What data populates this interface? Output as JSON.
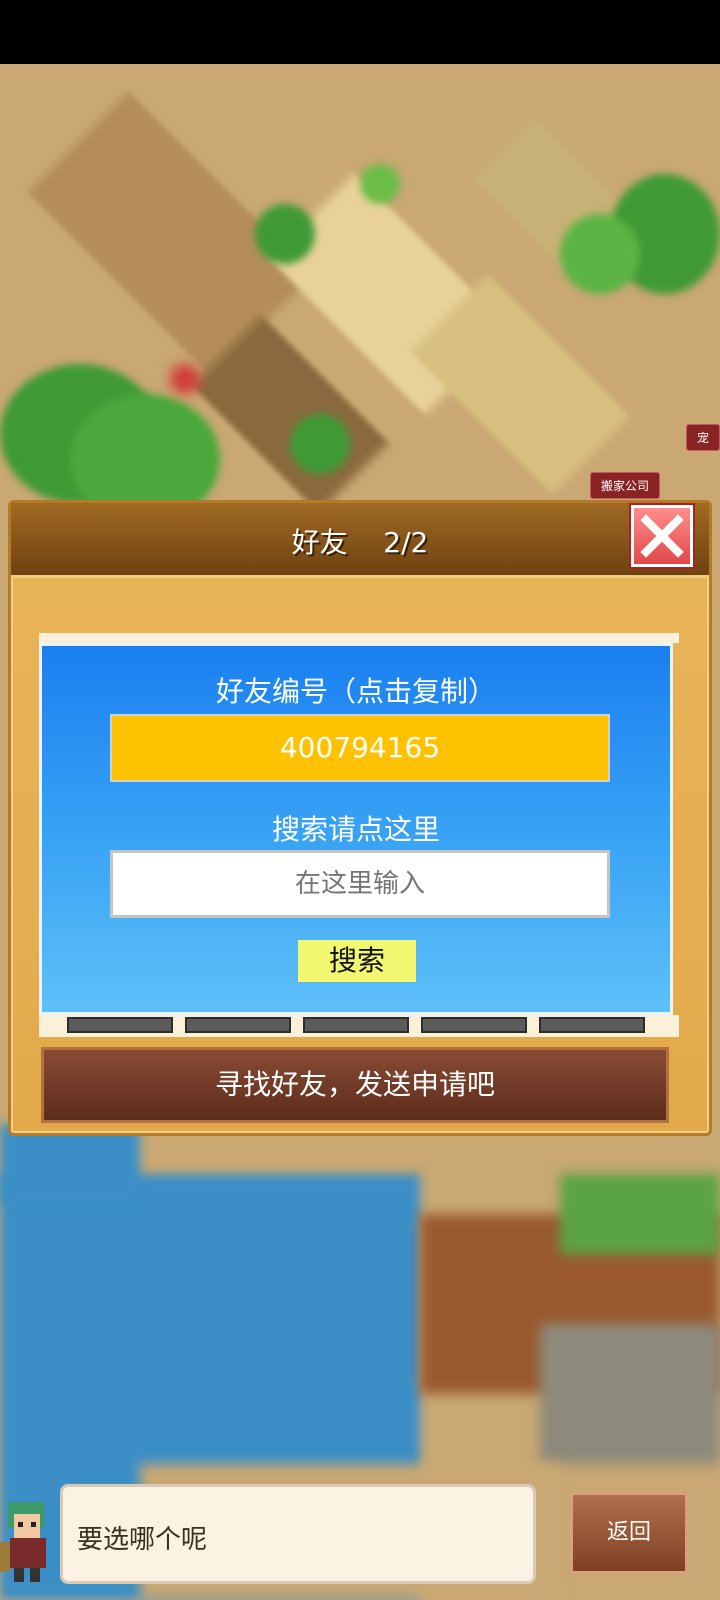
{
  "map": {
    "tags": [
      "搬家公司",
      "宠"
    ]
  },
  "panel": {
    "title": "好友",
    "page": "2/2"
  },
  "friend_card": {
    "code_label": "好友编号（点击复制）",
    "code_value": "400794165",
    "search_label": "搜索请点这里",
    "search_placeholder": "在这里输入",
    "search_button": "搜索"
  },
  "find_banner": "寻找好友，发送申请吧",
  "dialog": {
    "text": "要选哪个呢",
    "back_button": "返回"
  },
  "colors": {
    "code_box": "#ffc200",
    "search_button": "#f2f870",
    "card_top": "#1a7ff0",
    "close": "#e14848"
  }
}
